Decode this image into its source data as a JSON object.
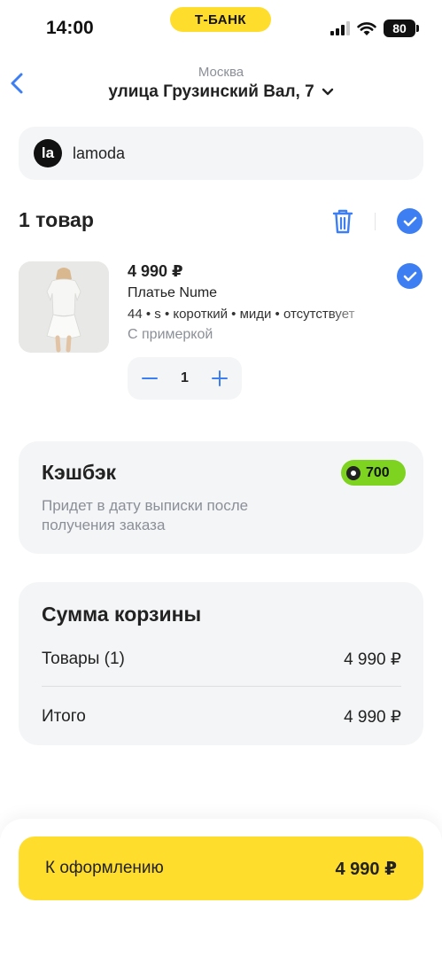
{
  "status_bar": {
    "time": "14:00",
    "bank_label": "Т-БАНК",
    "battery": "80",
    "icons": [
      "signal-icon",
      "wifi-icon",
      "battery-icon"
    ]
  },
  "header": {
    "city": "Москва",
    "address": "улица Грузинский Вал, 7",
    "icons": [
      "chevron-left-icon",
      "chevron-down-icon"
    ]
  },
  "seller": {
    "logo_text": "la",
    "name": "lamoda"
  },
  "items": {
    "title": "1 товар",
    "icons": [
      "trash-icon",
      "check-circle-icon"
    ]
  },
  "product": {
    "price": "4 990 ₽",
    "name": "Платье Nume",
    "params": "44 • s • короткий • миди • отсутствует",
    "fitting": "С примеркой",
    "quantity": "1",
    "image": "dress-photo"
  },
  "cashback": {
    "title": "Кэшбэк",
    "amount": "700",
    "description": "Придет в дату выписки после получения заказа"
  },
  "summary": {
    "title": "Сумма корзины",
    "goods_label": "Товары (1)",
    "goods_value": "4 990 ₽",
    "total_label": "Итого",
    "total_value": "4 990 ₽"
  },
  "checkout": {
    "label": "К оформлению",
    "total": "4 990 ₽"
  },
  "colors": {
    "accent_blue": "#3d7ff3",
    "brand_yellow": "#ffdd2d",
    "cashback_green": "#7ed321",
    "card_bg": "#f4f5f7"
  }
}
